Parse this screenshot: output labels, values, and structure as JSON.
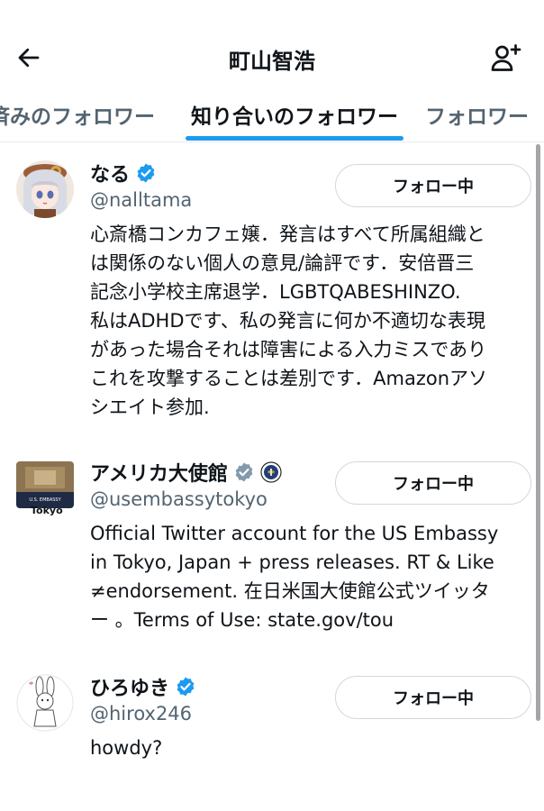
{
  "header": {
    "title": "町山智浩",
    "back_icon": "arrow-left-icon",
    "add_icon": "add-user-icon"
  },
  "tabs": [
    {
      "label": "済みのフォロワー",
      "active": false
    },
    {
      "label": "知り合いのフォロワー",
      "active": true
    },
    {
      "label": "フォロワー",
      "active": false
    }
  ],
  "colors": {
    "accent": "#1d9bf0",
    "verified_gray": "#829aab",
    "text": "#0f1419",
    "secondary": "#536471"
  },
  "users": [
    {
      "name": "なる",
      "handle": "@nalltama",
      "verified": "blue",
      "follow_label": "フォロー中",
      "bio_lines": [
        "心斎橋コンカフェ嬢．発言はすべて所属組織と",
        "は関係のない個人の意見/論評です．安倍晋三",
        "記念小学校主席退学．LGBTQABESHINZO.",
        "私はADHDです、私の発言に何か不適切な表現",
        "があった場合それは障害による入力ミスであり",
        "これを攻撃することは差別です．Amazonアソ",
        "シエイト参加."
      ]
    },
    {
      "name": "アメリカ大使館",
      "handle": "@usembassytokyo",
      "verified": "gray",
      "follow_label": "フォロー中",
      "avatar_text_top": "U.S. EMBASSY",
      "avatar_text_bottom": "Tokyo",
      "bio_lines": [
        "Official Twitter account for the US Embassy",
        "in Tokyo, Japan + press releases. RT & Like",
        "≠endorsement. 在日米国大使館公式ツイッタ",
        "ー 。Terms of Use: state.gov/tou"
      ]
    },
    {
      "name": "ひろゆき",
      "handle": "@hirox246",
      "verified": "blue",
      "follow_label": "フォロー中",
      "bio_lines": [
        "howdy?"
      ]
    }
  ]
}
